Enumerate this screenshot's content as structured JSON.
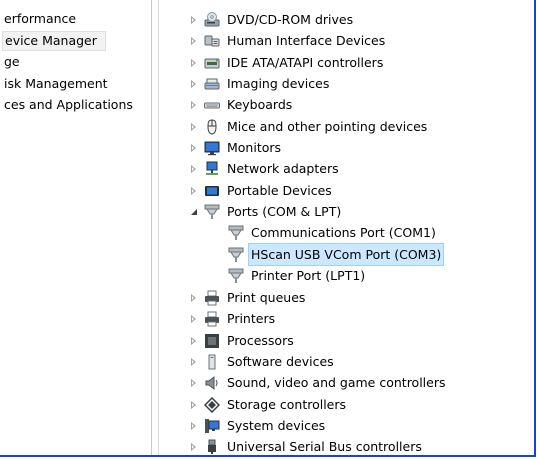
{
  "nav": {
    "items": [
      {
        "label": "erformance",
        "selected": false
      },
      {
        "label": "evice Manager",
        "selected": true
      },
      {
        "label": "ge",
        "selected": false
      },
      {
        "label": "isk Management",
        "selected": false
      },
      {
        "label": "ces and Applications",
        "selected": false
      }
    ]
  },
  "tree": {
    "items": [
      {
        "label": "DVD/CD-ROM drives",
        "icon": "optical-drive-icon",
        "expander": "collapsed"
      },
      {
        "label": "Human Interface Devices",
        "icon": "hid-icon",
        "expander": "collapsed"
      },
      {
        "label": "IDE ATA/ATAPI controllers",
        "icon": "ide-controller-icon",
        "expander": "collapsed"
      },
      {
        "label": "Imaging devices",
        "icon": "scanner-icon",
        "expander": "collapsed"
      },
      {
        "label": "Keyboards",
        "icon": "keyboard-icon",
        "expander": "collapsed"
      },
      {
        "label": "Mice and other pointing devices",
        "icon": "mouse-icon",
        "expander": "collapsed"
      },
      {
        "label": "Monitors",
        "icon": "monitor-icon",
        "expander": "collapsed"
      },
      {
        "label": "Network adapters",
        "icon": "network-adapter-icon",
        "expander": "collapsed"
      },
      {
        "label": "Portable Devices",
        "icon": "portable-device-icon",
        "expander": "collapsed"
      },
      {
        "label": "Ports (COM & LPT)",
        "icon": "port-icon",
        "expander": "expanded"
      },
      {
        "label": "Communications Port (COM1)",
        "icon": "port-icon",
        "child": true
      },
      {
        "label": "HScan USB VCom Port (COM3)",
        "icon": "port-icon",
        "child": true,
        "selected": true
      },
      {
        "label": "Printer Port (LPT1)",
        "icon": "port-icon",
        "child": true
      },
      {
        "label": "Print queues",
        "icon": "print-queue-icon",
        "expander": "collapsed"
      },
      {
        "label": "Printers",
        "icon": "printer-icon",
        "expander": "collapsed"
      },
      {
        "label": "Processors",
        "icon": "processor-icon",
        "expander": "collapsed"
      },
      {
        "label": "Software devices",
        "icon": "software-device-icon",
        "expander": "collapsed"
      },
      {
        "label": "Sound, video and game controllers",
        "icon": "speaker-icon",
        "expander": "collapsed"
      },
      {
        "label": "Storage controllers",
        "icon": "storage-controller-icon",
        "expander": "collapsed"
      },
      {
        "label": "System devices",
        "icon": "system-device-icon",
        "expander": "collapsed"
      },
      {
        "label": "Universal Serial Bus controllers",
        "icon": "usb-icon",
        "expander": "collapsed"
      }
    ]
  },
  "colors": {
    "frame_border": "#1c3fd4",
    "selection_fill": "#cce8ff",
    "selection_border": "#99d1ff"
  }
}
